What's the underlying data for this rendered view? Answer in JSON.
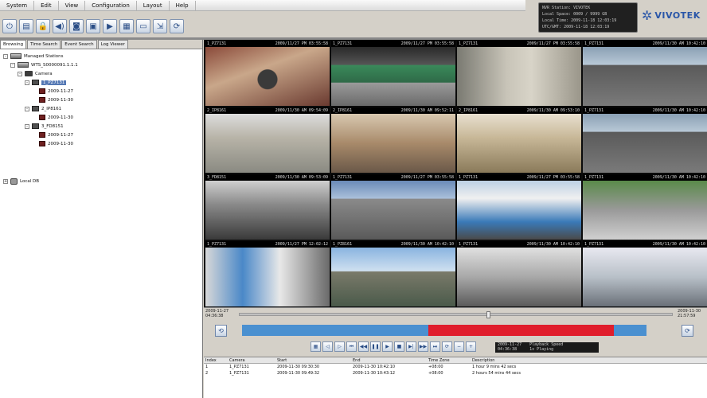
{
  "menu": [
    "System",
    "Edit",
    "View",
    "Configuration",
    "Layout",
    "Help"
  ],
  "toolbar_icons": [
    "power-icon",
    "rack-icon",
    "lock-icon",
    "speaker-icon",
    "camera-icon",
    "print-icon",
    "video-icon",
    "layout-grid-icon",
    "save-icon",
    "export-icon",
    "refresh-icon"
  ],
  "status": [
    "NVR Station: VIVOTEK",
    "Local Space: 0009 / 9999 GB",
    "Local Time: 2009-11-18 12:03:19",
    "UTC/GMT: 2009-11-18 12:03:19"
  ],
  "logo": "VIVOTEK",
  "tabs": [
    "Browsing",
    "Time Search",
    "Event Search",
    "Log Viewer"
  ],
  "tree": [
    {
      "label": "Managed Stations",
      "level": 0,
      "icon": "nvr",
      "exp": "-"
    },
    {
      "label": "WTS_S0000091.1.1.1",
      "level": 1,
      "icon": "nvr",
      "exp": "-"
    },
    {
      "label": "Camera",
      "level": 2,
      "icon": "folder",
      "exp": "-"
    },
    {
      "label": "1_PZ7131",
      "level": 3,
      "icon": "cam",
      "exp": "-",
      "selected": true
    },
    {
      "label": "2009-11-27",
      "level": 4,
      "icon": "date"
    },
    {
      "label": "2009-11-30",
      "level": 4,
      "icon": "date"
    },
    {
      "label": "2_IP8161",
      "level": 3,
      "icon": "cam",
      "exp": "-"
    },
    {
      "label": "2009-11-30",
      "level": 4,
      "icon": "date"
    },
    {
      "label": "3_FD8151",
      "level": 3,
      "icon": "cam",
      "exp": "-"
    },
    {
      "label": "2009-11-27",
      "level": 4,
      "icon": "date"
    },
    {
      "label": "2009-11-30",
      "level": 4,
      "icon": "date"
    },
    {
      "label": "Local DB",
      "level": 0,
      "icon": "disk",
      "exp": "+",
      "gap": true
    }
  ],
  "cells": [
    {
      "name": "1_PZ7131",
      "time": "2009/11/27 PM 03:55:58",
      "scene": "lobby"
    },
    {
      "name": "1_PZ7131",
      "time": "2009/11/27 PM 03:55:58",
      "scene": "parking"
    },
    {
      "name": "1_PZ7131",
      "time": "2009/11/27 PM 03:55:58",
      "scene": "room"
    },
    {
      "name": "1_PZ7131",
      "time": "2009/11/30 AM 10:42:10",
      "scene": "highway"
    },
    {
      "name": "2_IP8161",
      "time": "2009/11/30 AM 09:54:09",
      "scene": "station"
    },
    {
      "name": "2_IP8161",
      "time": "2009/11/30 AM 09:52:11",
      "scene": "lobby2"
    },
    {
      "name": "2_IP8161",
      "time": "2009/11/30 AM 09:53:10",
      "scene": "atrium"
    },
    {
      "name": "1_PZ7131",
      "time": "2009/11/30 AM 10:42:10",
      "scene": "highway"
    },
    {
      "name": "3_FD8151",
      "time": "2009/11/30 AM 09:53:09",
      "scene": "office"
    },
    {
      "name": "1_PZ7131",
      "time": "2009/11/27 PM 03:55:58",
      "scene": "parking2"
    },
    {
      "name": "1_PZ7131",
      "time": "2009/11/27 PM 03:55:58",
      "scene": "train"
    },
    {
      "name": "1_PZ7131",
      "time": "2009/11/30 AM 10:42:10",
      "scene": "street"
    },
    {
      "name": "1_PZ7131",
      "time": "2009/11/27 PM 12:02:12",
      "scene": "train2"
    },
    {
      "name": "1_PZ8161",
      "time": "2009/11/30 AM 10:42:10",
      "scene": "city"
    },
    {
      "name": "1_PZ7131",
      "time": "2009/11/30 AM 10:42:10",
      "scene": "platform"
    },
    {
      "name": "1_PZ7131",
      "time": "2009/11/30 AM 10:42:10",
      "scene": "hall"
    }
  ],
  "playback": {
    "start_date": "2009-11-27",
    "start_time": "04:36:38",
    "end_date": "2009-11-30",
    "end_time": "21:57:59",
    "thumb_pos": 0.57,
    "red_segments": [
      [
        0.46,
        0.92
      ]
    ],
    "controls": [
      "layout-icon",
      "prev-icon",
      "next-icon",
      "skip-back-icon",
      "rewind-icon",
      "pause-icon",
      "play-icon",
      "stop-icon",
      "step-icon",
      "fast-forward-icon",
      "skip-forward-icon",
      "sync-icon",
      "zoom-out-icon",
      "zoom-in-icon"
    ],
    "display_left": [
      "2009-11-27",
      "04:36:38"
    ],
    "display_right": [
      "Playback Speed",
      "1x Playing"
    ]
  },
  "list": {
    "headers": [
      "Index",
      "Camera",
      "Start",
      "End",
      "Time Zone",
      "Description"
    ],
    "rows": [
      [
        "1",
        "1_PZ7131",
        "2009-11-30 09:30:30",
        "2009-11-30 10:42:10",
        "+08:00",
        "1 hour 9 mins 42 secs"
      ],
      [
        "2",
        "1_PZ7131",
        "2009-11-30 09:49:32",
        "2009-11-30 10:43:12",
        "+08:00",
        "2 hours 54 mins 44 secs"
      ]
    ]
  },
  "colors": {
    "timeline_blue": "#4a90d0",
    "timeline_red": "#e01e2c"
  }
}
